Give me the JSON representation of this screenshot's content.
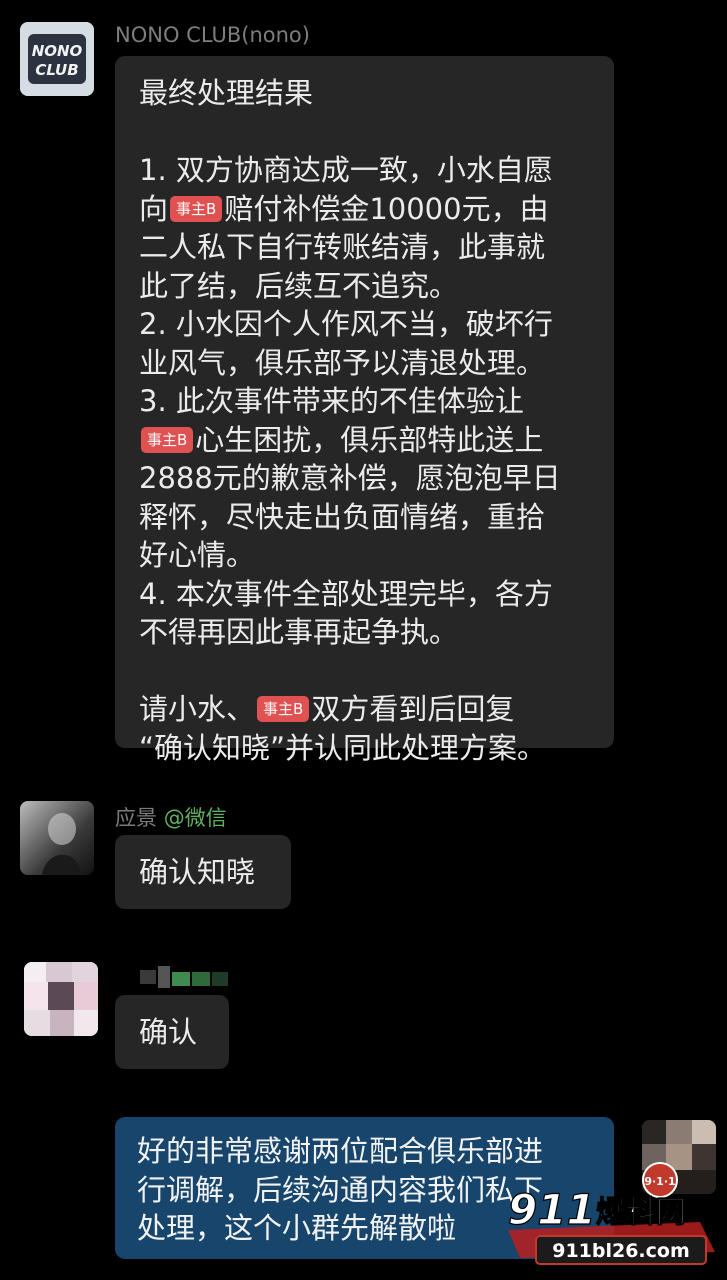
{
  "messages": [
    {
      "sender": "NONO CLUB(nono)",
      "avatar_icon": "nono-club-logo",
      "avatar_text_1": "NONO",
      "avatar_text_2": "CLUB",
      "lines": {
        "l1": "最终处理结果",
        "l3": "1. 双方协商达成一致，小水自愿",
        "l4a": "向",
        "l4tag": "事主B",
        "l4b": "赔付补偿金10000元，由",
        "l5": "二人私下自行转账结清，此事就",
        "l6": "此了结，后续互不追究。",
        "l7": "2. 小水因个人作风不当，破坏行",
        "l8": "业风气，俱乐部予以清退处理。",
        "l9": "3. 此次事件带来的不佳体验让",
        "l10tag": "事主B",
        "l10b": "心生困扰，俱乐部特此送上",
        "l11": "2888元的歉意补偿，愿泡泡早日",
        "l12": "释怀，尽快走出负面情绪，重拾",
        "l13": "好心情。",
        "l14": "4. 本次事件全部处理完毕，各方",
        "l15": "不得再因此事再起争执。",
        "l17a": "请小水、",
        "l17tag": "事主B",
        "l17b": "双方看到后回复",
        "l18": "“确认知晓”并认同此处理方案。"
      }
    },
    {
      "sender_name": "应景",
      "sender_platform": "@微信",
      "text": "确认知晓"
    },
    {
      "text": "确认"
    },
    {
      "lines": {
        "l1": "好的非常感谢两位配合俱乐部进",
        "l2": "行调解，后续沟通内容我们私下",
        "l3": "处理，这个小群先解散啦"
      },
      "is_mine": true
    }
  ],
  "watermark": {
    "badge": "9·1·1",
    "brand_number": "911",
    "brand_text": "爆料网",
    "url": "911bl26.com"
  },
  "colors": {
    "background": "#000000",
    "incoming_bubble": "#262626",
    "outgoing_bubble": "#17456c",
    "tag": "#e05252",
    "platform_green": "#5fb25f"
  }
}
